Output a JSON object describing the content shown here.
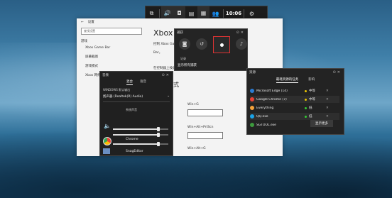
{
  "xbox_bar": {
    "clock": "10:06"
  },
  "settings": {
    "back_label": "←",
    "window_title": "设置",
    "search_placeholder": "查找设置",
    "nav_heading": "游戏",
    "nav_items": [
      "Xbox Game Bar",
      "屏幕截图",
      "游戏模式",
      "Xbox 网络"
    ],
    "title": "Xbox",
    "desc1": "控制 Xbox Game Bar...",
    "desc2": "Bar。",
    "open_text": "在控制器上按此按钮打开 Xbox Game Bar:",
    "section_title": "键盘快捷方式",
    "shortcuts": [
      "Win+G",
      "Win+Alt+PrtScn",
      "Win+Alt+G"
    ]
  },
  "capture": {
    "title": "捕获",
    "record_label": "记录",
    "show_all": "显示所有捕获"
  },
  "audio": {
    "title": "音频",
    "tab_mix": "混合",
    "tab_voice": "语音",
    "device_label": "WINDOWS 默认输出",
    "device_value": "扬声器 (Realtek(R) Audio)",
    "section_label": "系统声音",
    "app1": "Chrome",
    "app2": "SnagEditor",
    "vol1": 0.82,
    "vol2": 0.82,
    "vol3": 0.82
  },
  "resources": {
    "title": "资源",
    "tab_left": "最耗资源的任务",
    "tab_right": "影响",
    "rows": [
      {
        "name": "Microsoft Edge (14)",
        "level": "中等",
        "color": "#2b7cd3"
      },
      {
        "name": "Google Chrome (7)",
        "level": "中等",
        "color": "#e94235"
      },
      {
        "name": "Everything",
        "level": "低",
        "color": "#f4a23a"
      },
      {
        "name": "QQ.exe",
        "level": "低",
        "color": "#1aa3e8"
      },
      {
        "name": "SGTOOL.exe",
        "level": "低",
        "color": "#3d9a3d"
      }
    ],
    "more_button": "显示更多"
  }
}
